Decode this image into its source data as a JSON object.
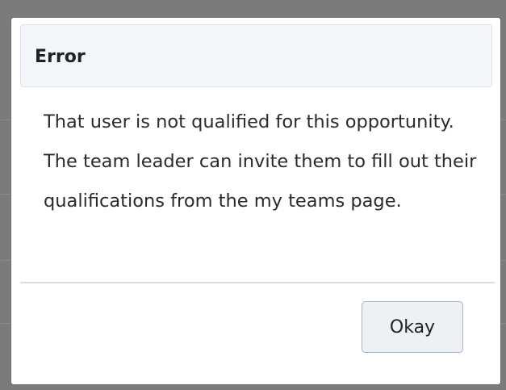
{
  "dialog": {
    "title": "Error",
    "message": "That user is not qualified for this opportunity. The team leader can invite them to fill out their qualifications from the my teams page.",
    "confirm_label": "Okay"
  },
  "colors": {
    "overlay": "#7b7b7b",
    "header_bg": "#f3f7fb",
    "button_bg": "#eef1f4",
    "button_border": "#a9b3bd"
  }
}
